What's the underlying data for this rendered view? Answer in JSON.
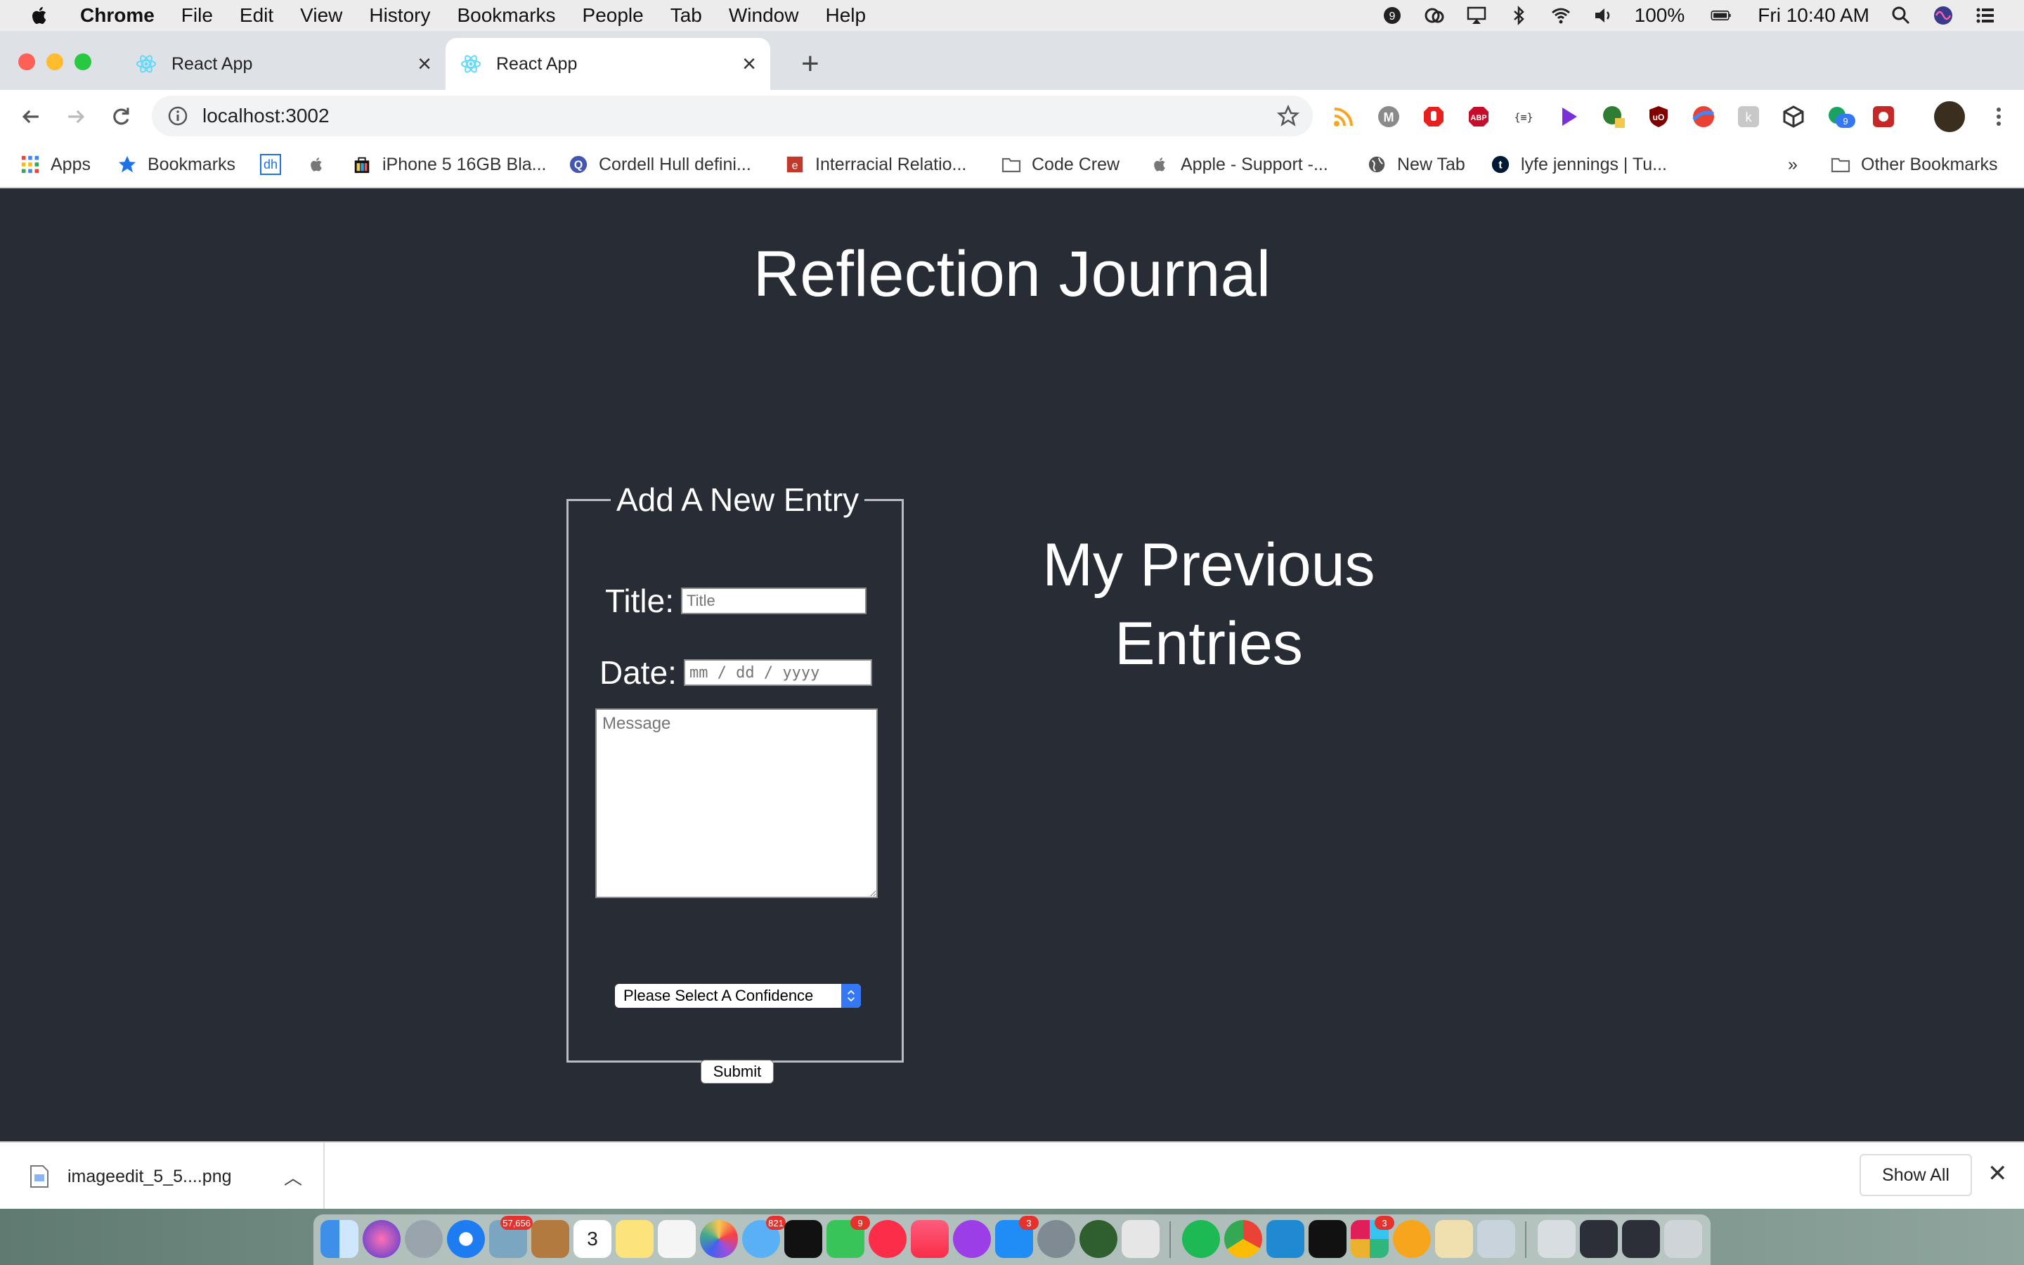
{
  "menubar": {
    "app_name": "Chrome",
    "menus": [
      "File",
      "Edit",
      "View",
      "History",
      "Bookmarks",
      "People",
      "Tab",
      "Window",
      "Help"
    ],
    "battery": "100%",
    "clock": "Fri 10:40 AM"
  },
  "tabs": [
    {
      "title": "React App",
      "active": false
    },
    {
      "title": "React App",
      "active": true
    }
  ],
  "toolbar": {
    "url": "localhost:3002"
  },
  "bookmarks": {
    "apps": "Apps",
    "bookmarks": "Bookmarks",
    "dh": "dh",
    "items": [
      "iPhone 5 16GB Bla...",
      "Cordell Hull defini...",
      "Interracial Relatio...",
      "Code Crew",
      "Apple - Support -...",
      "New Tab",
      "lyfe jennings | Tu..."
    ],
    "overflow": "»",
    "other": "Other Bookmarks"
  },
  "page": {
    "title": "Reflection Journal",
    "form": {
      "legend": "Add A New Entry",
      "title_label": "Title:",
      "title_placeholder": "Title",
      "date_label": "Date:",
      "date_placeholder": "mm / dd / yyyy",
      "message_placeholder": "Message",
      "confidence_selected": "Please Select A Confidence",
      "submit_label": "Submit"
    },
    "previous_heading": "My Previous Entries"
  },
  "download": {
    "filename": "imageedit_5_5....png",
    "show_all": "Show All"
  },
  "dock": {
    "badges": {
      "photos": "57,656",
      "calendar_date": "3",
      "messages": "821",
      "facetime": "9",
      "appstore": "3",
      "slack": "3"
    }
  },
  "extension_badge": "9",
  "colors": {
    "page_bg": "#282c34",
    "accent_blue": "#3478f6"
  }
}
